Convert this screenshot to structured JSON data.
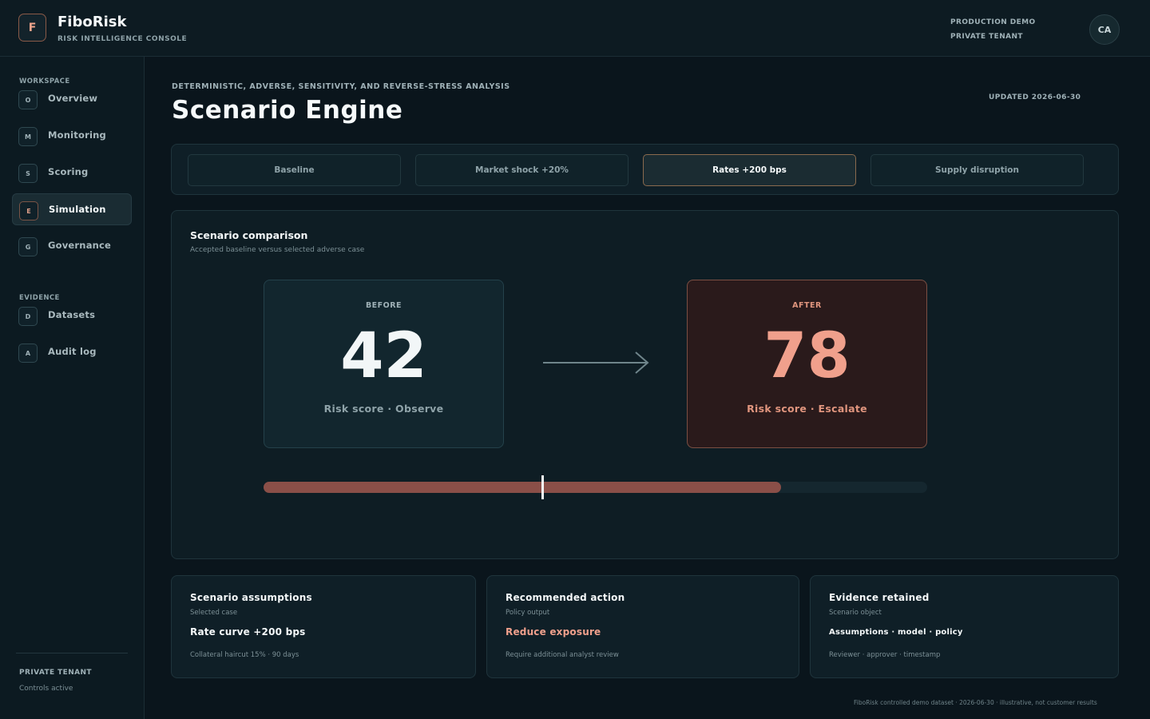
{
  "app": {
    "logo_letter": "F",
    "name": "FiboRisk",
    "subtitle": "RISK INTELLIGENCE CONSOLE",
    "environment": "PRODUCTION DEMO",
    "tenant": "PRIVATE TENANT",
    "avatar_initials": "CA"
  },
  "sidebar": {
    "workspace_label": "WORKSPACE",
    "workspace_items": [
      {
        "icon": "O",
        "label": "Overview"
      },
      {
        "icon": "M",
        "label": "Monitoring"
      },
      {
        "icon": "S",
        "label": "Scoring"
      },
      {
        "icon": "E",
        "label": "Simulation",
        "active": true
      },
      {
        "icon": "G",
        "label": "Governance"
      }
    ],
    "evidence_label": "EVIDENCE",
    "evidence_items": [
      {
        "icon": "D",
        "label": "Datasets"
      },
      {
        "icon": "A",
        "label": "Audit log"
      }
    ],
    "tenant_title": "PRIVATE TENANT",
    "tenant_status": "Controls active"
  },
  "header": {
    "eyebrow": "DETERMINISTIC, ADVERSE, SENSITIVITY, AND REVERSE-STRESS ANALYSIS",
    "title": "Scenario Engine",
    "updated": "UPDATED 2026-06-30"
  },
  "scenario_tabs": [
    {
      "label": "Baseline"
    },
    {
      "label": "Market shock +20%"
    },
    {
      "label": "Rates +200 bps",
      "active": true
    },
    {
      "label": "Supply disruption"
    }
  ],
  "comparison": {
    "title": "Scenario comparison",
    "subtitle": "Accepted baseline versus selected adverse case",
    "before": {
      "label": "BEFORE",
      "score": "42",
      "caption": "Risk score · Observe"
    },
    "after": {
      "label": "AFTER",
      "score": "78",
      "caption": "Risk score · Escalate"
    },
    "scale": {
      "max": 100,
      "baseline_marker": 42,
      "fill_value": 78
    },
    "colors": {
      "before_accent": "#12262e",
      "after_accent": "#f0a08c",
      "fill": "#8a4f48"
    }
  },
  "cards": [
    {
      "title": "Scenario assumptions",
      "subtitle": "Selected case",
      "value": "Rate curve +200 bps",
      "note": "Collateral haircut 15% · 90 days"
    },
    {
      "title": "Recommended action",
      "subtitle": "Policy output",
      "value": "Reduce exposure",
      "note": "Require additional analyst review"
    },
    {
      "title": "Evidence retained",
      "subtitle": "Scenario object",
      "value": "Assumptions · model · policy",
      "note": "Reviewer · approver · timestamp"
    }
  ],
  "footer": "FiboRisk controlled demo dataset · 2026-06-30 · illustrative, not customer results"
}
